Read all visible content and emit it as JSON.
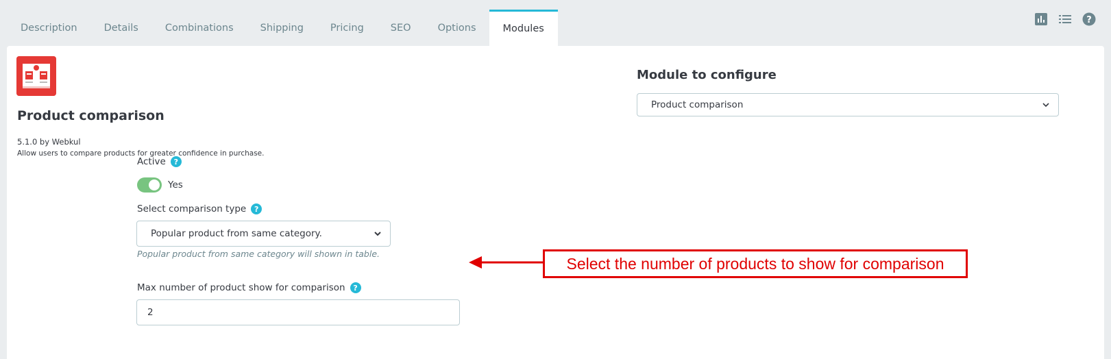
{
  "tabs": [
    {
      "label": "Description"
    },
    {
      "label": "Details"
    },
    {
      "label": "Combinations"
    },
    {
      "label": "Shipping"
    },
    {
      "label": "Pricing"
    },
    {
      "label": "SEO"
    },
    {
      "label": "Options"
    },
    {
      "label": "Modules",
      "active": true
    }
  ],
  "top_icons": [
    "chart-icon",
    "list-icon",
    "help-icon"
  ],
  "module": {
    "title": "Product comparison",
    "version": "5.1.0 by Webkul",
    "description": "Allow users to compare products for greater confidence in purchase."
  },
  "form": {
    "active_label": "Active",
    "active_value": "Yes",
    "active_on": true,
    "comparison_type_label": "Select comparison type",
    "comparison_type_value": "Popular product from same category.",
    "comparison_type_hint": "Popular product from same category will shown in table.",
    "max_products_label": "Max number of product show for comparison",
    "max_products_value": "2"
  },
  "module_config": {
    "heading": "Module to configure",
    "selected": "Product comparison"
  },
  "annotation": {
    "text": "Select the number of products to show for comparison"
  },
  "colors": {
    "accent": "#25b9d7",
    "switch_on": "#78c480",
    "annotation": "#e00000",
    "logo_red": "#e53935"
  }
}
